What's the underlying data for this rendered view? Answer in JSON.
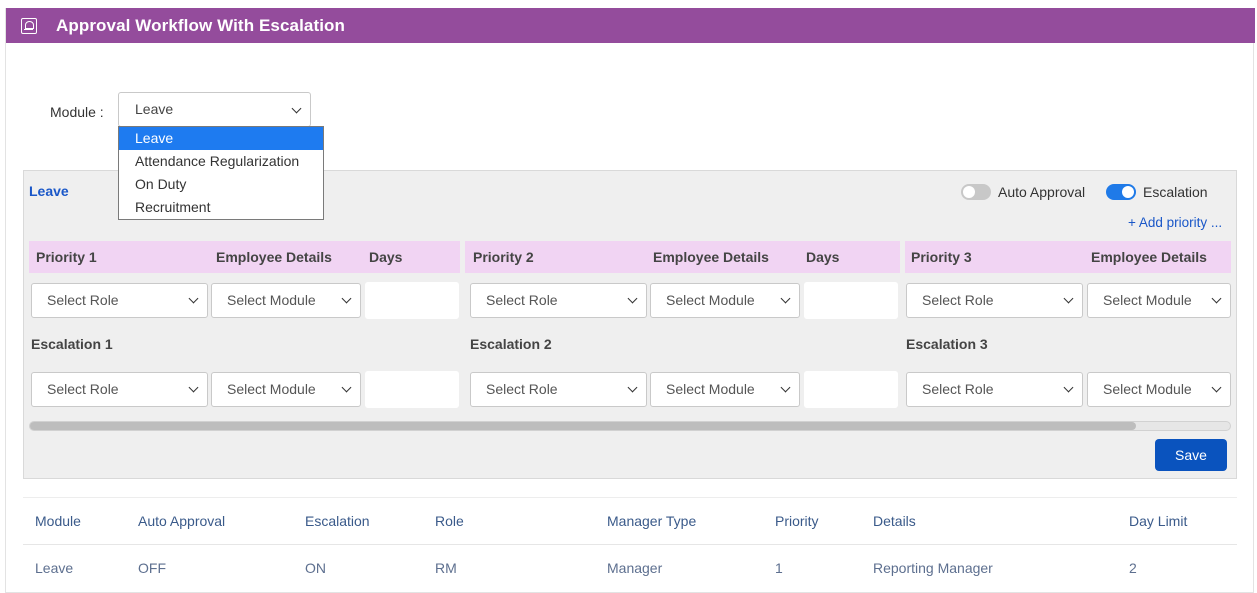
{
  "header": {
    "title": "Approval Workflow With Escalation",
    "icon": "user-profile-icon"
  },
  "module": {
    "label": "Module :",
    "selected": "Leave",
    "options": [
      "Leave",
      "Attendance Regularization",
      "On Duty",
      "Recruitment"
    ]
  },
  "panel": {
    "title": "Leave",
    "auto_approval_label": "Auto Approval",
    "auto_approval_on": false,
    "escalation_label": "Escalation",
    "escalation_on": true,
    "add_priority": "+ Add priority ..."
  },
  "priorities": [
    {
      "priority": "Priority 1",
      "employee_details": "Employee Details",
      "days": "Days",
      "escalation": "Escalation 1"
    },
    {
      "priority": "Priority 2",
      "employee_details": "Employee Details",
      "days": "Days",
      "escalation": "Escalation 2"
    },
    {
      "priority": "Priority 3",
      "employee_details": "Employee Details",
      "escalation": "Escalation 3"
    }
  ],
  "selects": {
    "role_placeholder": "Select Role",
    "module_placeholder": "Select Module"
  },
  "save_label": "Save",
  "table": {
    "columns": [
      "Module",
      "Auto Approval",
      "Escalation",
      "Role",
      "Manager Type",
      "Priority",
      "Details",
      "Day Limit"
    ],
    "rows": [
      [
        "Leave",
        "OFF",
        "ON",
        "RM",
        "Manager",
        "1",
        "Reporting Manager",
        "2"
      ]
    ]
  },
  "colors": {
    "title_bar": "#944c9c",
    "accent": "#1f7ae8",
    "priority_header": "#f1d4f3",
    "save_button": "#0a53be"
  }
}
